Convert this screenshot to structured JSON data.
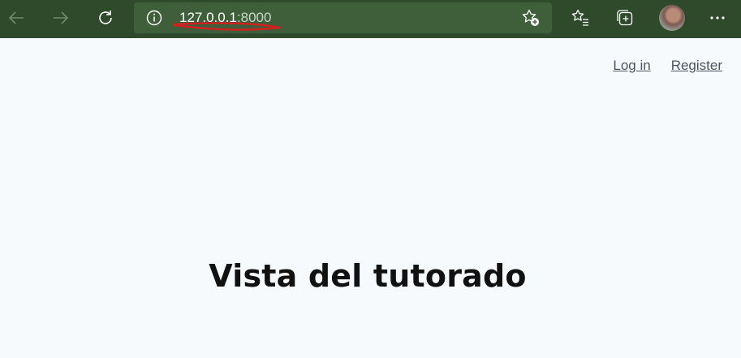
{
  "browser": {
    "url_host": "127.0.0.1",
    "url_rest": ":8000",
    "icons": {
      "back": "back-arrow-icon",
      "forward": "forward-arrow-icon",
      "refresh": "refresh-icon",
      "site_info": "info-icon",
      "add_favorite": "star-add-icon",
      "favorites": "favorites-list-icon",
      "collections": "collections-icon",
      "profile": "avatar",
      "menu": "more-icon"
    },
    "colors": {
      "toolbar": "#2e4a2a",
      "address_bar": "#3f5f3a",
      "annotation": "#d21f1f"
    }
  },
  "page": {
    "nav": {
      "login_label": "Log in",
      "register_label": "Register"
    },
    "heading": "Vista del tutorado",
    "background": "#f7fafc"
  }
}
